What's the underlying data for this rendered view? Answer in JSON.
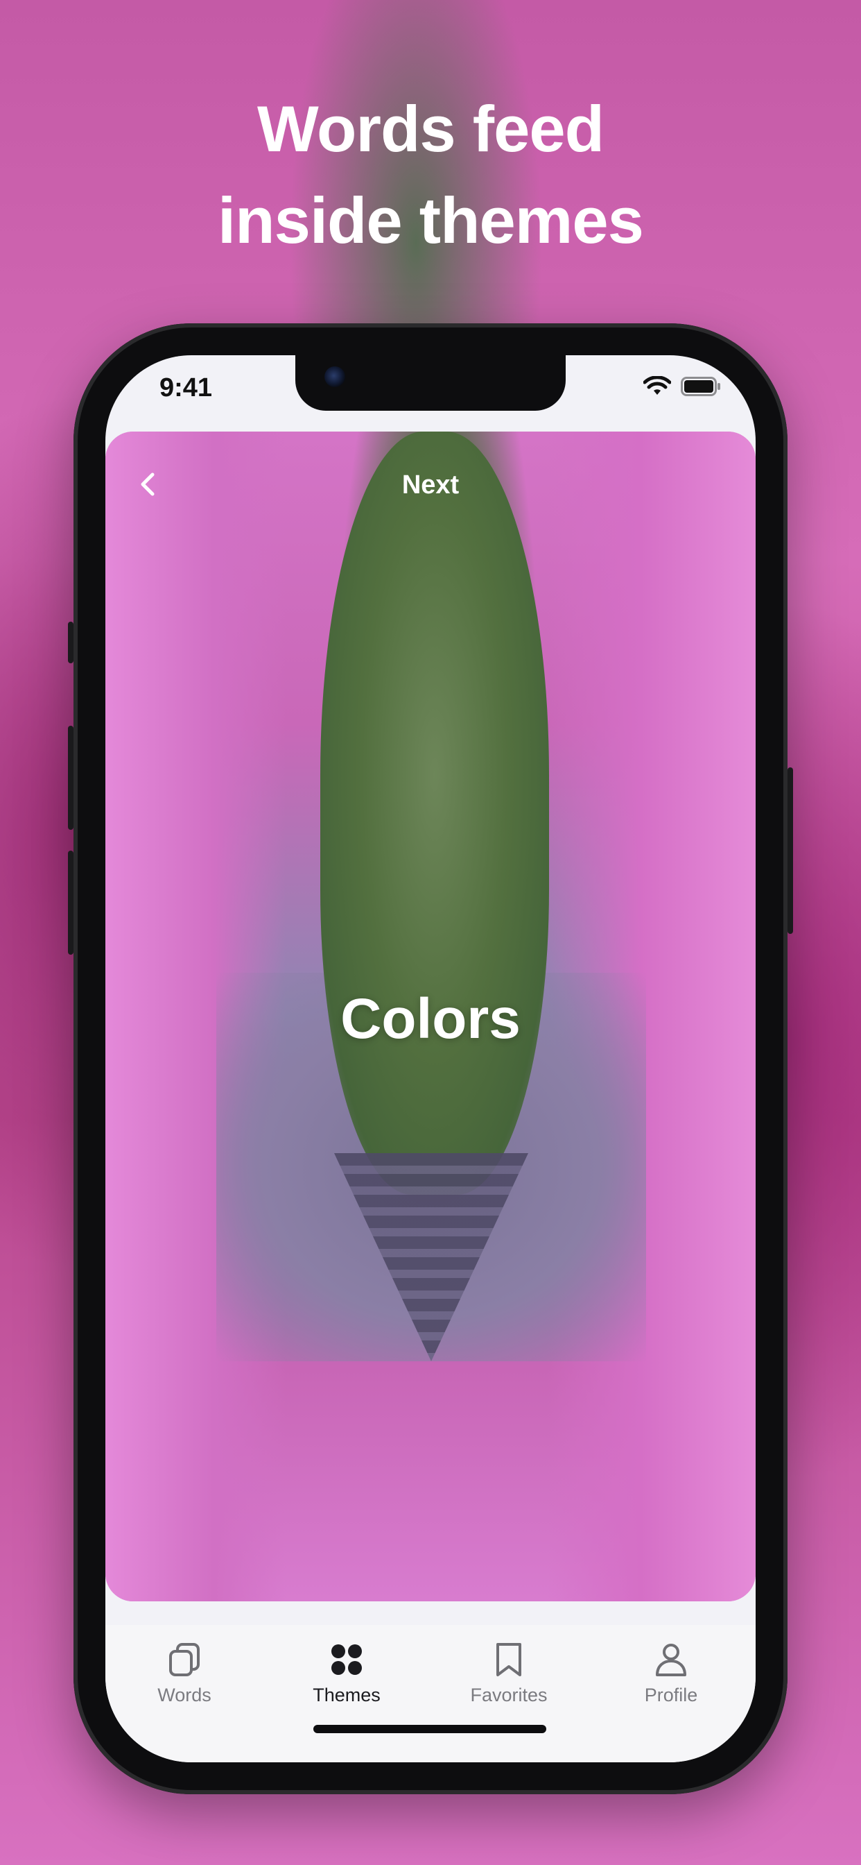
{
  "headline": {
    "line1": "Words feed",
    "line2": "inside themes"
  },
  "status_bar": {
    "time": "9:41",
    "icons": [
      "wifi-icon",
      "battery-icon"
    ]
  },
  "hero": {
    "nav_title": "Next",
    "theme_title": "Colors",
    "back_icon": "chevron-left-icon"
  },
  "tabs": [
    {
      "label": "Words",
      "icon": "cards-icon",
      "active": false
    },
    {
      "label": "Themes",
      "icon": "grid-dots-icon",
      "active": true
    },
    {
      "label": "Favorites",
      "icon": "bookmark-icon",
      "active": false
    },
    {
      "label": "Profile",
      "icon": "person-icon",
      "active": false
    }
  ],
  "colors": {
    "active_tab": "#1b1b1f",
    "inactive_tab": "#7b7b80",
    "text_on_image": "#ffffff"
  }
}
